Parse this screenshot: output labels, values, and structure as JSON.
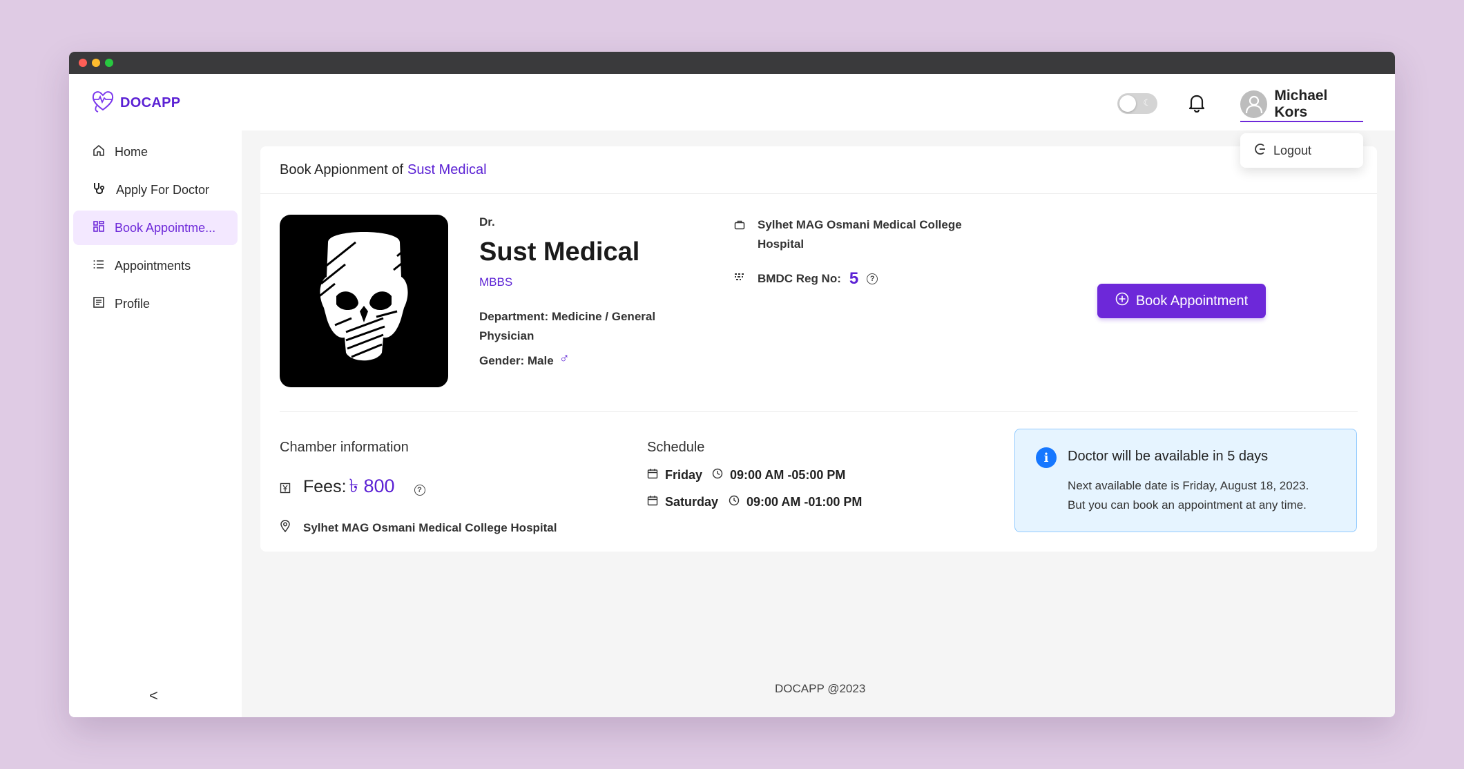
{
  "app": {
    "name": "DOCAPP",
    "brand_color": "#5b21d4"
  },
  "header": {
    "user_name": "Michael Kors",
    "dropdown": {
      "logout_label": "Logout"
    }
  },
  "sidebar": {
    "items": [
      {
        "label": "Home",
        "icon": "home-icon"
      },
      {
        "label": "Apply For Doctor",
        "icon": "stethoscope-icon"
      },
      {
        "label": "Book Appointme...",
        "icon": "grid-icon",
        "active": true
      },
      {
        "label": "Appointments",
        "icon": "list-icon"
      },
      {
        "label": "Profile",
        "icon": "profile-icon"
      }
    ],
    "collapse_label": "<"
  },
  "card": {
    "title_prefix": "Book Appionment of",
    "title_name": "Sust Medical"
  },
  "doctor": {
    "prefix": "Dr.",
    "name": "Sust Medical",
    "degree": "MBBS",
    "department": "Department: Medicine / General Physician",
    "gender": "Gender: Male",
    "gender_symbol": "♂",
    "hospital": "Sylhet MAG Osmani Medical College Hospital",
    "bmdc_label": "BMDC Reg No:",
    "bmdc_value": "5"
  },
  "book_button_label": "Book Appointment",
  "chamber": {
    "title": "Chamber information",
    "fees_label": "Fees:",
    "fees_value": "৳ 800",
    "address": "Sylhet MAG Osmani Medical College Hospital"
  },
  "schedule": {
    "title": "Schedule",
    "rows": [
      {
        "day": "Friday",
        "time": "09:00 AM -05:00 PM"
      },
      {
        "day": "Saturday",
        "time": "09:00 AM -01:00 PM"
      }
    ]
  },
  "info": {
    "title": "Doctor will be available in 5 days",
    "line1": "Next available date is Friday, August 18, 2023.",
    "line2": "But you can book an appointment at any time."
  },
  "footer": "DOCAPP @2023"
}
